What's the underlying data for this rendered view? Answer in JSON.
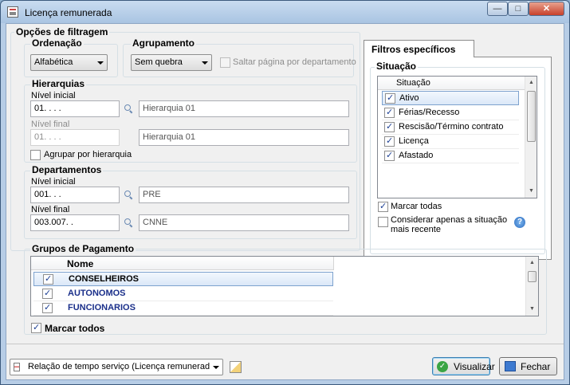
{
  "window": {
    "title": "Licença remunerada"
  },
  "filter": {
    "title": "Opções de filtragem",
    "ordenacao": {
      "label": "Ordenação",
      "value": "Alfabética"
    },
    "agrupamento": {
      "label": "Agrupamento",
      "value": "Sem quebra",
      "saltar_label": "Saltar página por departamento"
    },
    "hierarquias": {
      "label": "Hierarquias",
      "nivel_inicial_label": "Nível inicial",
      "nivel_inicial_value": "01.   .   .   .",
      "nivel_inicial_desc": "Hierarquia 01",
      "nivel_final_label": "Nível final",
      "nivel_final_value": "01.   .   .   .",
      "nivel_final_desc": "Hierarquia 01",
      "agrupar_label": "Agrupar por hierarquia"
    },
    "departamentos": {
      "label": "Departamentos",
      "nivel_inicial_label": "Nível inicial",
      "nivel_inicial_value": "001.   .   .",
      "nivel_inicial_desc": "PRE",
      "nivel_final_label": "Nível final",
      "nivel_final_value": "003.007.   .",
      "nivel_final_desc": "CNNE"
    }
  },
  "especificos": {
    "tab": "Filtros específicos",
    "situacao_label": "Situação",
    "list_header": "Situação",
    "items": [
      {
        "label": "Ativo",
        "checked": true
      },
      {
        "label": "Férias/Recesso",
        "checked": true
      },
      {
        "label": "Rescisão/Término contrato",
        "checked": true
      },
      {
        "label": "Licença",
        "checked": true
      },
      {
        "label": "Afastado",
        "checked": true
      }
    ],
    "marcar_todas": "Marcar todas",
    "considerar": "Considerar apenas a situação\nmais recente"
  },
  "grupos": {
    "label": "Grupos de  Pagamento",
    "header": "Nome",
    "items": [
      {
        "label": "CONSELHEIROS",
        "checked": true
      },
      {
        "label": "AUTONOMOS",
        "checked": true
      },
      {
        "label": "FUNCIONARIOS",
        "checked": true
      }
    ],
    "marcar_todos": "Marcar todos"
  },
  "footer": {
    "report": "Relação de tempo serviço (Licença remunerada)",
    "visualizar": "Visualizar",
    "fechar": "Fechar"
  },
  "colors": {
    "accent": "#1c3f94",
    "list_text": "#1a2f8a"
  }
}
